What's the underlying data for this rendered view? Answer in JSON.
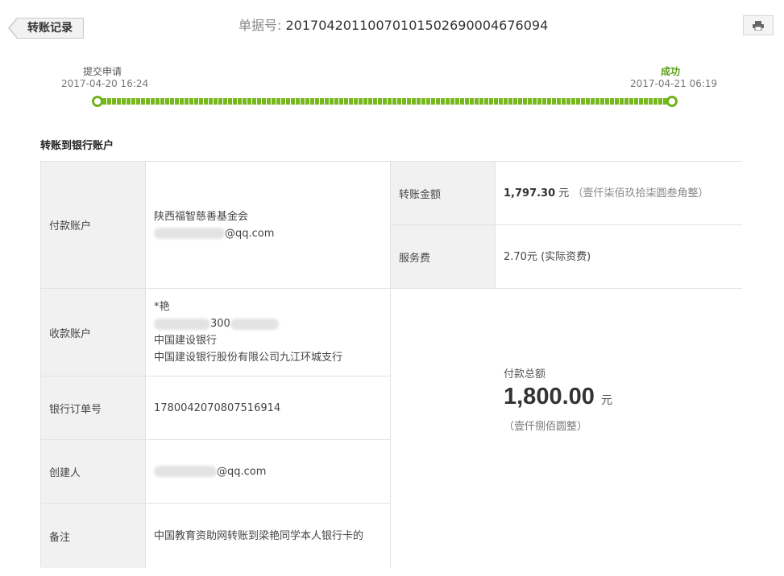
{
  "header": {
    "back_label": "转账记录",
    "order_label": "单据号:",
    "order_number": "20170420110070101502690004676094",
    "print_icon": "printer-icon"
  },
  "progress": {
    "start": {
      "label": "提交申请",
      "time": "2017-04-20 16:24"
    },
    "end": {
      "label": "成功",
      "time": "2017-04-21 06:19"
    },
    "accent_color": "#6fb319"
  },
  "section_title": "转账到银行账户",
  "details": {
    "payer": {
      "label": "付款账户",
      "name": "陕西福智慈善基金会",
      "email_suffix": "@qq.com"
    },
    "payee": {
      "label": "收款账户",
      "name": "*艳",
      "account_fragment": "300",
      "bank": "中国建设银行",
      "branch": "中国建设银行股份有限公司九江环城支行"
    },
    "bank_order": {
      "label": "银行订单号",
      "value": "1780042070807516914"
    },
    "creator": {
      "label": "创建人",
      "email_suffix": "@qq.com"
    },
    "remark": {
      "label": "备注",
      "value": "中国教育资助网转账到梁艳同学本人银行卡的"
    },
    "transfer_amount": {
      "label": "转账金额",
      "value": "1,797.30",
      "unit": "元",
      "words": "（壹仟柒佰玖拾柒圆叁角整）"
    },
    "service_fee": {
      "label": "服务费",
      "value": "2.70元 (实际资费)"
    },
    "total": {
      "label": "付款总额",
      "value": "1,800.00",
      "unit": "元",
      "words": "（壹仟捌佰圆整）"
    }
  }
}
